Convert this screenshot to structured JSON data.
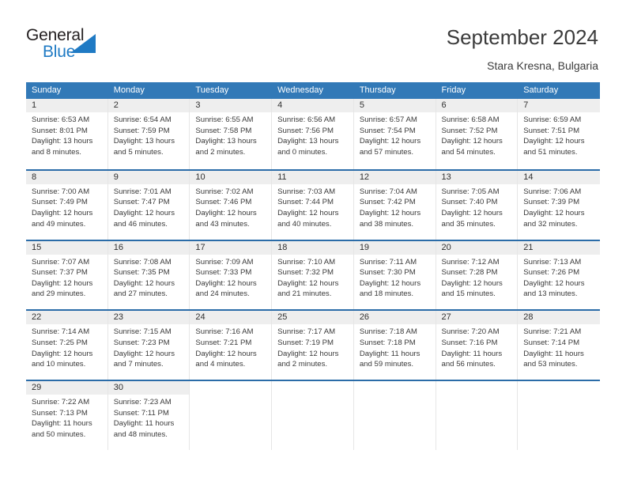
{
  "brand": {
    "word_one": "General",
    "word_two": "Blue",
    "accent_color": "#1f7ac4",
    "triangle_icon": "brand-triangle-icon"
  },
  "header": {
    "title": "September 2024",
    "subtitle": "Stara Kresna, Bulgaria"
  },
  "calendar": {
    "header_bg": "#3279b7",
    "week_divider_color": "#2b6ca8",
    "daynum_band_bg": "#eeeeee",
    "weekday_headers": [
      "Sunday",
      "Monday",
      "Tuesday",
      "Wednesday",
      "Thursday",
      "Friday",
      "Saturday"
    ],
    "labels": {
      "sunrise": "Sunrise:",
      "sunset": "Sunset:",
      "daylight": "Daylight:"
    },
    "weeks": [
      [
        {
          "day": "1",
          "sunrise": "Sunrise: 6:53 AM",
          "sunset": "Sunset: 8:01 PM",
          "daylight_1": "Daylight: 13 hours",
          "daylight_2": "and 8 minutes."
        },
        {
          "day": "2",
          "sunrise": "Sunrise: 6:54 AM",
          "sunset": "Sunset: 7:59 PM",
          "daylight_1": "Daylight: 13 hours",
          "daylight_2": "and 5 minutes."
        },
        {
          "day": "3",
          "sunrise": "Sunrise: 6:55 AM",
          "sunset": "Sunset: 7:58 PM",
          "daylight_1": "Daylight: 13 hours",
          "daylight_2": "and 2 minutes."
        },
        {
          "day": "4",
          "sunrise": "Sunrise: 6:56 AM",
          "sunset": "Sunset: 7:56 PM",
          "daylight_1": "Daylight: 13 hours",
          "daylight_2": "and 0 minutes."
        },
        {
          "day": "5",
          "sunrise": "Sunrise: 6:57 AM",
          "sunset": "Sunset: 7:54 PM",
          "daylight_1": "Daylight: 12 hours",
          "daylight_2": "and 57 minutes."
        },
        {
          "day": "6",
          "sunrise": "Sunrise: 6:58 AM",
          "sunset": "Sunset: 7:52 PM",
          "daylight_1": "Daylight: 12 hours",
          "daylight_2": "and 54 minutes."
        },
        {
          "day": "7",
          "sunrise": "Sunrise: 6:59 AM",
          "sunset": "Sunset: 7:51 PM",
          "daylight_1": "Daylight: 12 hours",
          "daylight_2": "and 51 minutes."
        }
      ],
      [
        {
          "day": "8",
          "sunrise": "Sunrise: 7:00 AM",
          "sunset": "Sunset: 7:49 PM",
          "daylight_1": "Daylight: 12 hours",
          "daylight_2": "and 49 minutes."
        },
        {
          "day": "9",
          "sunrise": "Sunrise: 7:01 AM",
          "sunset": "Sunset: 7:47 PM",
          "daylight_1": "Daylight: 12 hours",
          "daylight_2": "and 46 minutes."
        },
        {
          "day": "10",
          "sunrise": "Sunrise: 7:02 AM",
          "sunset": "Sunset: 7:46 PM",
          "daylight_1": "Daylight: 12 hours",
          "daylight_2": "and 43 minutes."
        },
        {
          "day": "11",
          "sunrise": "Sunrise: 7:03 AM",
          "sunset": "Sunset: 7:44 PM",
          "daylight_1": "Daylight: 12 hours",
          "daylight_2": "and 40 minutes."
        },
        {
          "day": "12",
          "sunrise": "Sunrise: 7:04 AM",
          "sunset": "Sunset: 7:42 PM",
          "daylight_1": "Daylight: 12 hours",
          "daylight_2": "and 38 minutes."
        },
        {
          "day": "13",
          "sunrise": "Sunrise: 7:05 AM",
          "sunset": "Sunset: 7:40 PM",
          "daylight_1": "Daylight: 12 hours",
          "daylight_2": "and 35 minutes."
        },
        {
          "day": "14",
          "sunrise": "Sunrise: 7:06 AM",
          "sunset": "Sunset: 7:39 PM",
          "daylight_1": "Daylight: 12 hours",
          "daylight_2": "and 32 minutes."
        }
      ],
      [
        {
          "day": "15",
          "sunrise": "Sunrise: 7:07 AM",
          "sunset": "Sunset: 7:37 PM",
          "daylight_1": "Daylight: 12 hours",
          "daylight_2": "and 29 minutes."
        },
        {
          "day": "16",
          "sunrise": "Sunrise: 7:08 AM",
          "sunset": "Sunset: 7:35 PM",
          "daylight_1": "Daylight: 12 hours",
          "daylight_2": "and 27 minutes."
        },
        {
          "day": "17",
          "sunrise": "Sunrise: 7:09 AM",
          "sunset": "Sunset: 7:33 PM",
          "daylight_1": "Daylight: 12 hours",
          "daylight_2": "and 24 minutes."
        },
        {
          "day": "18",
          "sunrise": "Sunrise: 7:10 AM",
          "sunset": "Sunset: 7:32 PM",
          "daylight_1": "Daylight: 12 hours",
          "daylight_2": "and 21 minutes."
        },
        {
          "day": "19",
          "sunrise": "Sunrise: 7:11 AM",
          "sunset": "Sunset: 7:30 PM",
          "daylight_1": "Daylight: 12 hours",
          "daylight_2": "and 18 minutes."
        },
        {
          "day": "20",
          "sunrise": "Sunrise: 7:12 AM",
          "sunset": "Sunset: 7:28 PM",
          "daylight_1": "Daylight: 12 hours",
          "daylight_2": "and 15 minutes."
        },
        {
          "day": "21",
          "sunrise": "Sunrise: 7:13 AM",
          "sunset": "Sunset: 7:26 PM",
          "daylight_1": "Daylight: 12 hours",
          "daylight_2": "and 13 minutes."
        }
      ],
      [
        {
          "day": "22",
          "sunrise": "Sunrise: 7:14 AM",
          "sunset": "Sunset: 7:25 PM",
          "daylight_1": "Daylight: 12 hours",
          "daylight_2": "and 10 minutes."
        },
        {
          "day": "23",
          "sunrise": "Sunrise: 7:15 AM",
          "sunset": "Sunset: 7:23 PM",
          "daylight_1": "Daylight: 12 hours",
          "daylight_2": "and 7 minutes."
        },
        {
          "day": "24",
          "sunrise": "Sunrise: 7:16 AM",
          "sunset": "Sunset: 7:21 PM",
          "daylight_1": "Daylight: 12 hours",
          "daylight_2": "and 4 minutes."
        },
        {
          "day": "25",
          "sunrise": "Sunrise: 7:17 AM",
          "sunset": "Sunset: 7:19 PM",
          "daylight_1": "Daylight: 12 hours",
          "daylight_2": "and 2 minutes."
        },
        {
          "day": "26",
          "sunrise": "Sunrise: 7:18 AM",
          "sunset": "Sunset: 7:18 PM",
          "daylight_1": "Daylight: 11 hours",
          "daylight_2": "and 59 minutes."
        },
        {
          "day": "27",
          "sunrise": "Sunrise: 7:20 AM",
          "sunset": "Sunset: 7:16 PM",
          "daylight_1": "Daylight: 11 hours",
          "daylight_2": "and 56 minutes."
        },
        {
          "day": "28",
          "sunrise": "Sunrise: 7:21 AM",
          "sunset": "Sunset: 7:14 PM",
          "daylight_1": "Daylight: 11 hours",
          "daylight_2": "and 53 minutes."
        }
      ],
      [
        {
          "day": "29",
          "sunrise": "Sunrise: 7:22 AM",
          "sunset": "Sunset: 7:13 PM",
          "daylight_1": "Daylight: 11 hours",
          "daylight_2": "and 50 minutes."
        },
        {
          "day": "30",
          "sunrise": "Sunrise: 7:23 AM",
          "sunset": "Sunset: 7:11 PM",
          "daylight_1": "Daylight: 11 hours",
          "daylight_2": "and 48 minutes."
        },
        {
          "day": "",
          "sunrise": "",
          "sunset": "",
          "daylight_1": "",
          "daylight_2": ""
        },
        {
          "day": "",
          "sunrise": "",
          "sunset": "",
          "daylight_1": "",
          "daylight_2": ""
        },
        {
          "day": "",
          "sunrise": "",
          "sunset": "",
          "daylight_1": "",
          "daylight_2": ""
        },
        {
          "day": "",
          "sunrise": "",
          "sunset": "",
          "daylight_1": "",
          "daylight_2": ""
        },
        {
          "day": "",
          "sunrise": "",
          "sunset": "",
          "daylight_1": "",
          "daylight_2": ""
        }
      ]
    ]
  }
}
